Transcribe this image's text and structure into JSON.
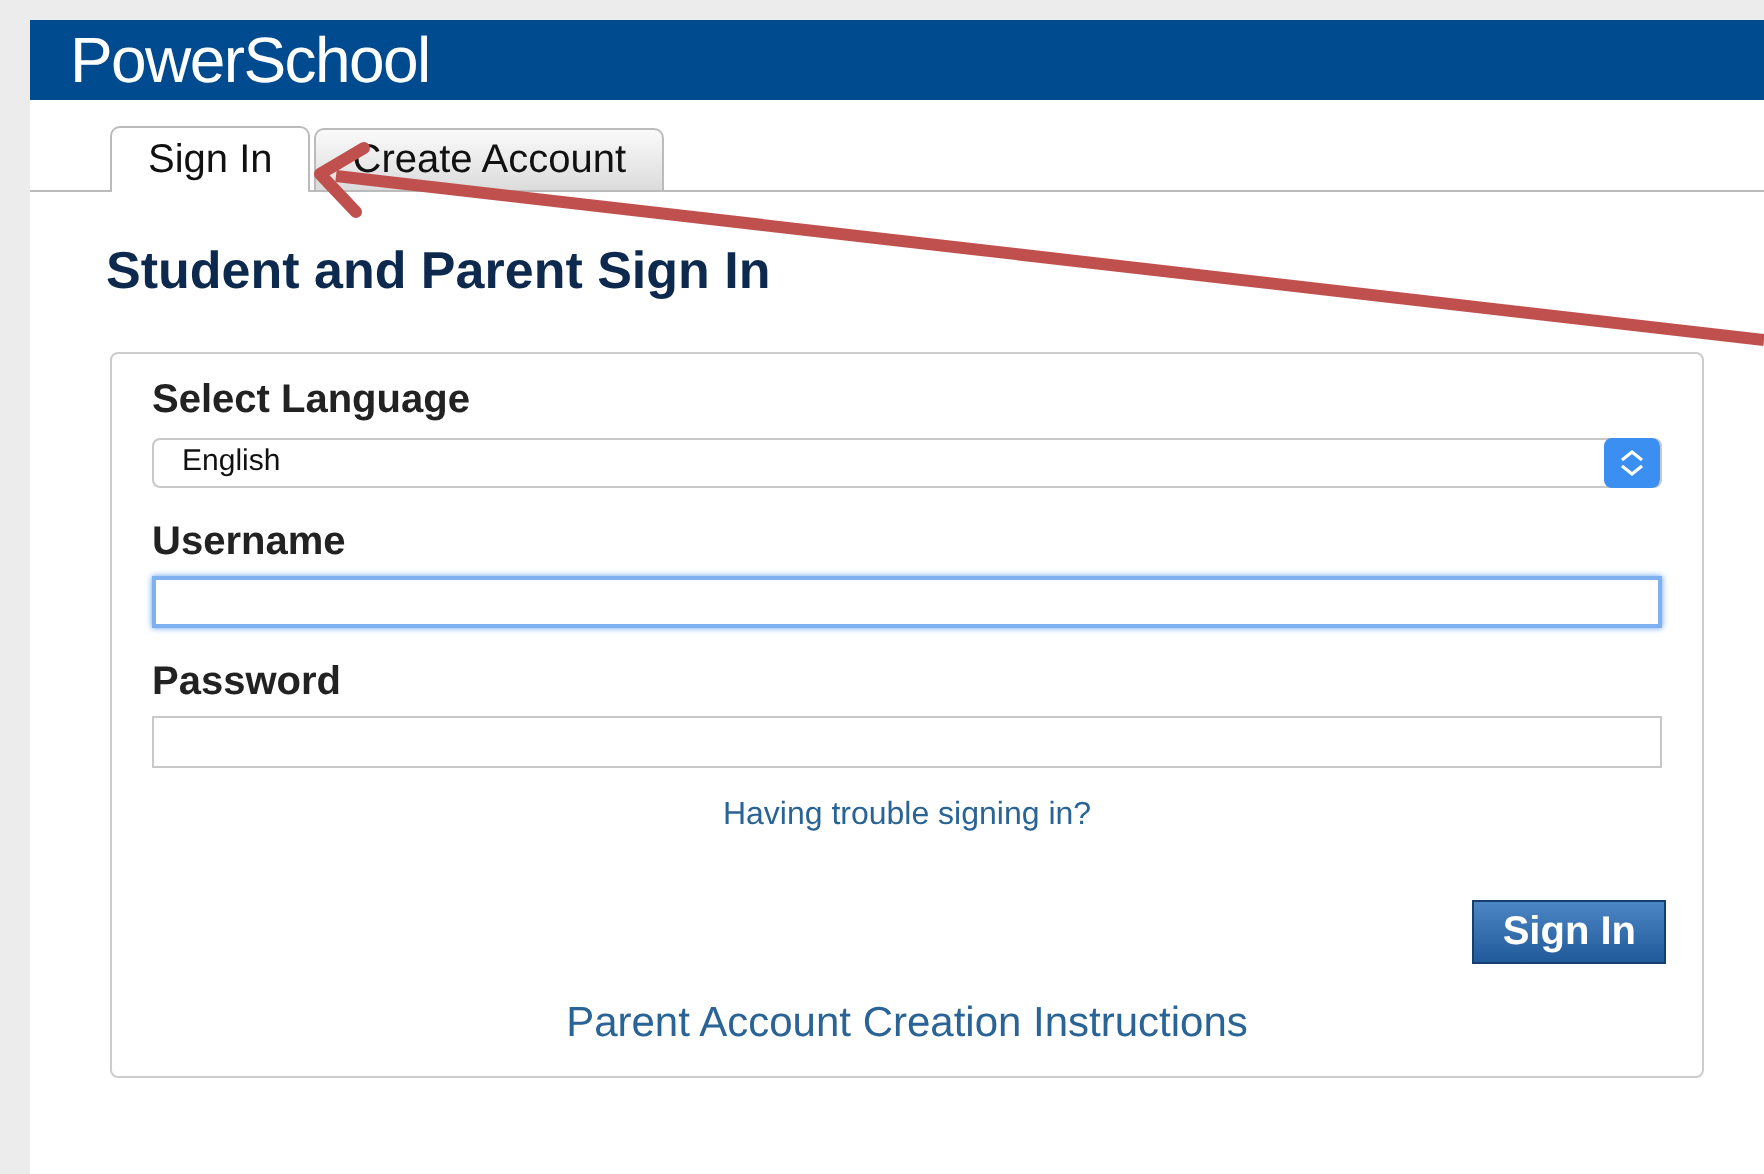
{
  "header": {
    "logo": "PowerSchool"
  },
  "tabs": [
    {
      "label": "Sign In",
      "selected": true
    },
    {
      "label": "Create Account",
      "selected": false
    }
  ],
  "heading": "Student and Parent Sign In",
  "form": {
    "language_label": "Select Language",
    "language_value": "English",
    "username_label": "Username",
    "username_focused": true,
    "password_label": "Password",
    "password_focused": false,
    "trouble_link": "Having trouble signing in?",
    "submit": "Sign In",
    "instructions_link": "Parent Account Creation Instructions"
  },
  "annotation": {
    "kind": "arrow",
    "color": "#c0504d"
  }
}
